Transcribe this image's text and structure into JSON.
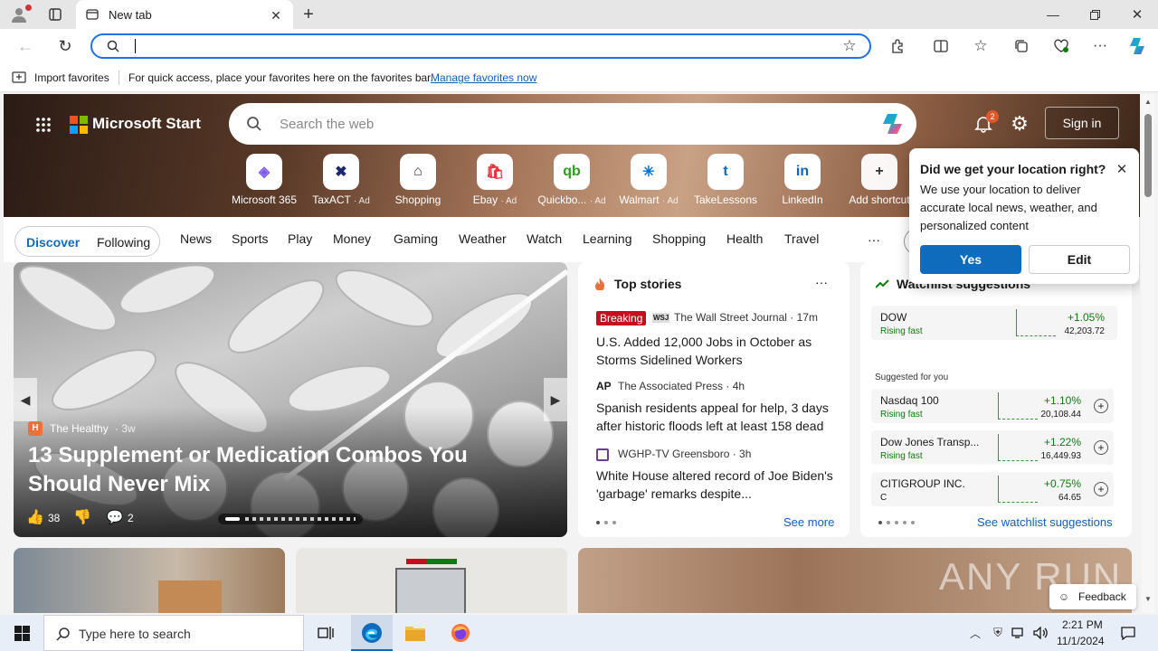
{
  "browser": {
    "tab_title": "New tab",
    "address_value": "",
    "favorites_bar": {
      "import_label": "Import favorites",
      "message": "For quick access, place your favorites here on the favorites bar.",
      "manage_link": "Manage favorites now"
    }
  },
  "start": {
    "brand": "Microsoft Start",
    "search_placeholder": "Search the web",
    "notification_count": "2",
    "sign_in": "Sign in",
    "quick_links": [
      {
        "label": "Microsoft 365",
        "ad": "",
        "icon": "microsoft-365-icon"
      },
      {
        "label": "TaxACT",
        "ad": "· Ad",
        "icon": "taxact-icon"
      },
      {
        "label": "Shopping",
        "ad": "",
        "icon": "shopping-tag-icon"
      },
      {
        "label": "Ebay",
        "ad": "· Ad",
        "icon": "ebay-icon"
      },
      {
        "label": "Quickbo...",
        "ad": "· Ad",
        "icon": "quickbooks-icon"
      },
      {
        "label": "Walmart",
        "ad": "· Ad",
        "icon": "walmart-icon"
      },
      {
        "label": "TakeLessons",
        "ad": "",
        "icon": "takelessons-icon"
      },
      {
        "label": "LinkedIn",
        "ad": "",
        "icon": "linkedin-icon"
      },
      {
        "label": "Add shortcut",
        "ad": "",
        "icon": "plus-icon"
      }
    ],
    "feed_tabs": {
      "discover": "Discover",
      "following": "Following"
    },
    "nav": [
      "News",
      "Sports",
      "Play",
      "Money",
      "Gaming",
      "Weather",
      "Watch",
      "Learning",
      "Shopping",
      "Health",
      "Travel"
    ],
    "more": "···"
  },
  "location_popup": {
    "title": "Did we get your location right?",
    "body": "We use your location to deliver accurate local news, weather, and personalized content",
    "yes": "Yes",
    "edit": "Edit"
  },
  "hero_story": {
    "source": "The Healthy",
    "age": "· 3w",
    "title": "13 Supplement or Medication Combos You Should Never Mix",
    "likes": "38",
    "comments": "2"
  },
  "top_stories": {
    "heading": "Top stories",
    "items": [
      {
        "badge": "Breaking",
        "logo": "WSJ",
        "source": "The Wall Street Journal · 17m",
        "title": "U.S. Added 12,000 Jobs in October as Storms Sidelined Workers"
      },
      {
        "badge": "",
        "logo": "AP",
        "source": "The Associated Press · 4h",
        "title": "Spanish residents appeal for help, 3 days after historic floods left at least 158 dead"
      },
      {
        "badge": "",
        "logo": "",
        "source": "WGHP-TV Greensboro · 3h",
        "title": "White House altered record of Joe Biden's 'garbage' remarks despite..."
      }
    ],
    "see_more": "See more"
  },
  "watchlist": {
    "heading": "Watchlist suggestions",
    "top": {
      "name": "DOW",
      "sub": "Rising fast",
      "pct": "+1.05%",
      "value": "42,203.72"
    },
    "suggested_label": "Suggested for you",
    "items": [
      {
        "name": "Nasdaq 100",
        "sub": "Rising fast",
        "pct": "+1.10%",
        "value": "20,108.44"
      },
      {
        "name": "Dow Jones Transp...",
        "sub": "Rising fast",
        "pct": "+1.22%",
        "value": "16,449.93"
      },
      {
        "name": "CITIGROUP INC.",
        "sub": "C",
        "pct": "+0.75%",
        "value": "64.65"
      }
    ],
    "see_link": "See watchlist suggestions"
  },
  "feedback": "Feedback",
  "watermark": "ANY RUN",
  "taskbar": {
    "search_placeholder": "Type here to search",
    "time": "2:21 PM",
    "date": "11/1/2024"
  }
}
